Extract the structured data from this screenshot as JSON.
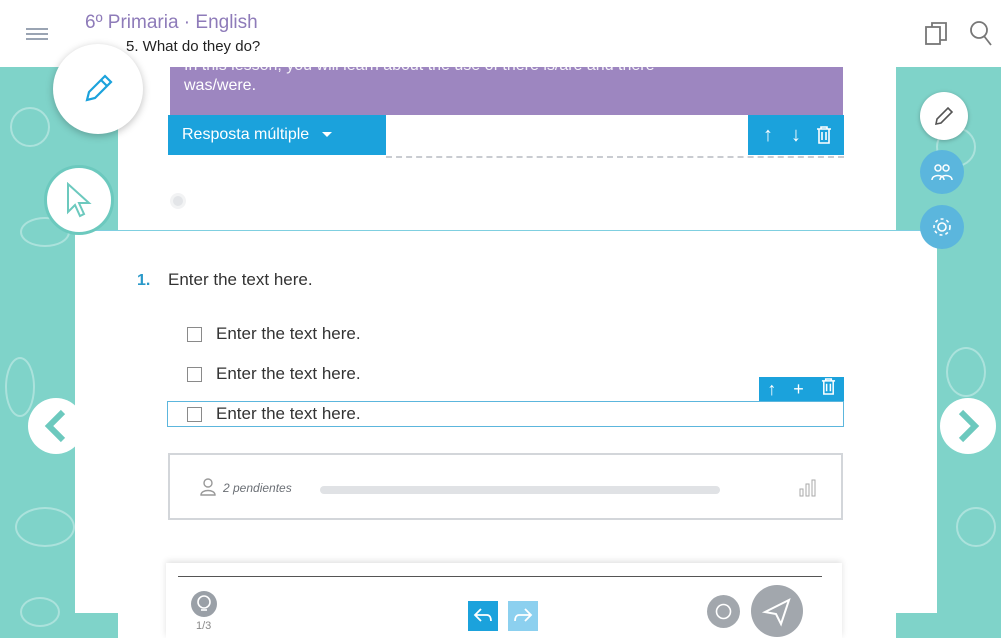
{
  "header": {
    "course_title": "6º Primaria · English",
    "unit_title": "5. What do they do?"
  },
  "banner": {
    "text_partial": "In this lesson, you will learn about the use of there is/are and there",
    "text_line2": "was/were."
  },
  "toolbar": {
    "activity_type_label": "Resposta múltiple"
  },
  "question": {
    "number": "1.",
    "text": "Enter the text here.",
    "options": [
      {
        "label": "Enter the text here."
      },
      {
        "label": "Enter the text here."
      },
      {
        "label": "Enter the text here."
      }
    ]
  },
  "progress": {
    "pending_text": "2 pendientes"
  },
  "footer": {
    "page_indicator": "1/3"
  },
  "colors": {
    "accent_blue": "#1ba2dc",
    "purple": "#9d86c0",
    "teal": "#7fd3c9",
    "title_purple": "#8e7bb9"
  }
}
